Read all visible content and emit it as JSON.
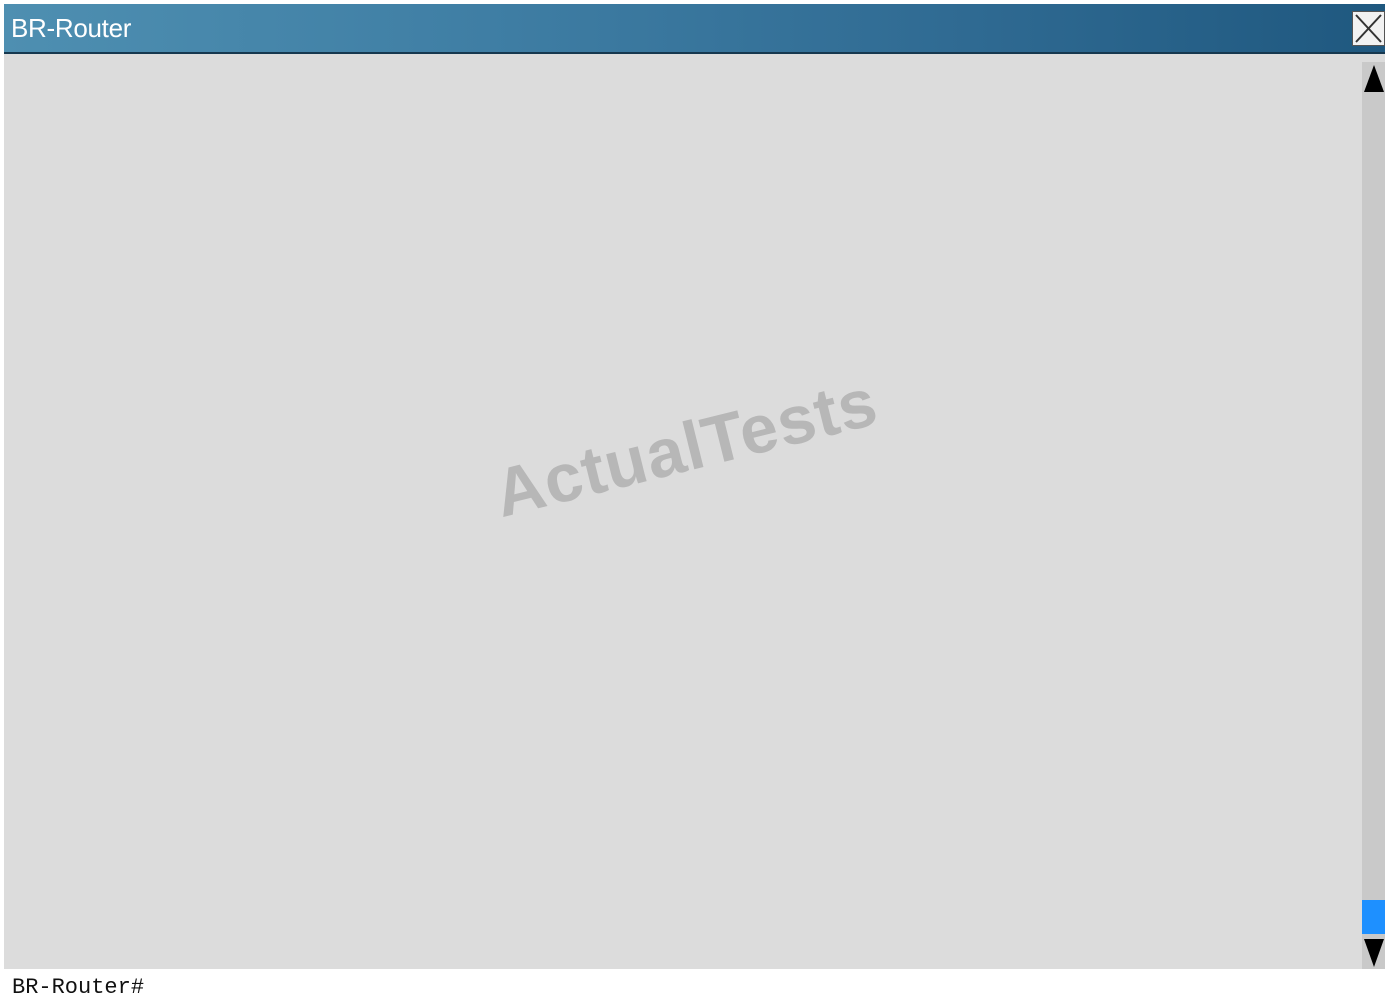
{
  "window": {
    "title": "BR-Router"
  },
  "console": {
    "prompt": "BR-Router#",
    "watermark": "ActualTests"
  },
  "scrollbar": {
    "position": 1.0
  },
  "colors": {
    "titlebar": "#3f7ea4",
    "background": "#dcdcdc",
    "scroll_thumb": "#1e90ff"
  },
  "icons": {
    "close": "close-icon",
    "scroll_up": "arrow-up-icon",
    "scroll_down": "arrow-down-icon"
  }
}
